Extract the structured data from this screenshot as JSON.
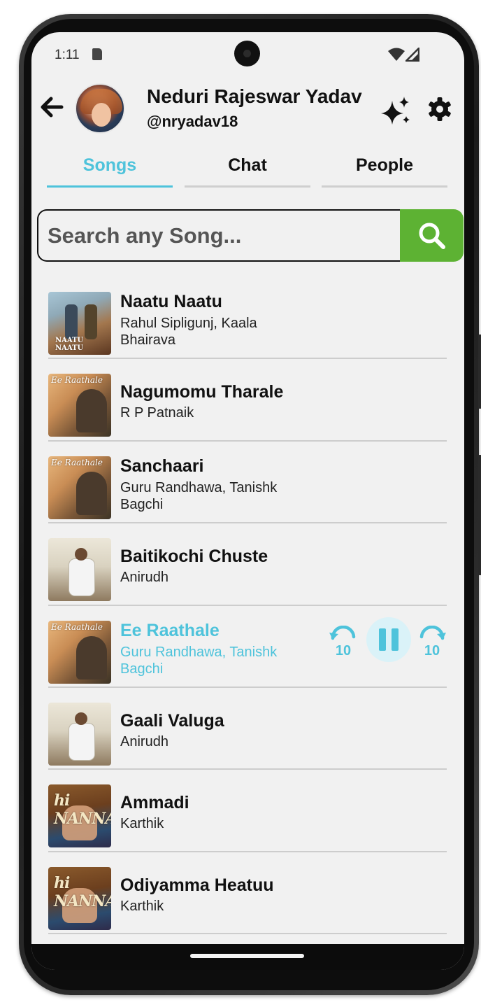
{
  "status_bar": {
    "time": "1:11",
    "icons": [
      "sd-card-icon",
      "wifi-icon",
      "signal-icon"
    ]
  },
  "header": {
    "user_name": "Neduri Rajeswar Yadav",
    "user_handle": "@nryadav18",
    "icons": [
      "back-arrow-icon",
      "avatar",
      "sparkle-icon",
      "gear-icon"
    ]
  },
  "tabs": [
    {
      "label": "Songs",
      "active": true
    },
    {
      "label": "Chat",
      "active": false
    },
    {
      "label": "People",
      "active": false
    }
  ],
  "search": {
    "placeholder": "Search any Song...",
    "value": "",
    "button_icon": "search-icon"
  },
  "songs": [
    {
      "title": "Naatu Naatu",
      "artist": "Rahul Sipligunj, Kaala Bhairava",
      "cover_text": "NAATU NAATU"
    },
    {
      "title": "Nagumomu Tharale",
      "artist": "R P Patnaik",
      "cover_text": "Ee Raathale"
    },
    {
      "title": "Sanchaari",
      "artist": "Guru Randhawa, Tanishk Bagchi",
      "cover_text": "Ee Raathale"
    },
    {
      "title": "Baitikochi Chuste",
      "artist": "Anirudh",
      "cover_text": ""
    },
    {
      "title": "Ee Raathale",
      "artist": "Guru Randhawa, Tanishk Bagchi",
      "cover_text": "Ee Raathale",
      "playing": true
    },
    {
      "title": "Gaali Valuga",
      "artist": "Anirudh",
      "cover_text": ""
    },
    {
      "title": "Ammadi",
      "artist": "Karthik",
      "cover_text": "hi NANNA"
    },
    {
      "title": "Odiyamma Heatuu",
      "artist": "Karthik",
      "cover_text": "hi NANNA"
    }
  ],
  "player": {
    "controls": [
      "rewind-10-icon",
      "pause-icon",
      "forward-10-icon"
    ],
    "rewind_label": "10",
    "forward_label": "10"
  },
  "colors": {
    "accent": "#4ec3db",
    "search_button": "#5db233",
    "background": "#f1f1f1",
    "text": "#111111"
  }
}
